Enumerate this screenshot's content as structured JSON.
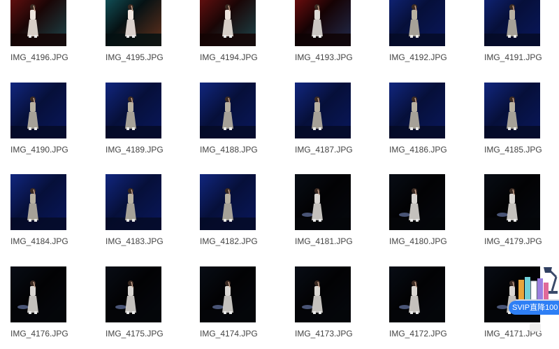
{
  "files": [
    {
      "name": "IMG_4196.JPG",
      "scene": "red-stage"
    },
    {
      "name": "IMG_4195.JPG",
      "scene": "teal-stage"
    },
    {
      "name": "IMG_4194.JPG",
      "scene": "red-stage"
    },
    {
      "name": "IMG_4193.JPG",
      "scene": "red-stage-far"
    },
    {
      "name": "IMG_4192.JPG",
      "scene": "blue-stage"
    },
    {
      "name": "IMG_4191.JPG",
      "scene": "blue-stage"
    },
    {
      "name": "IMG_4190.JPG",
      "scene": "blue-stage"
    },
    {
      "name": "IMG_4189.JPG",
      "scene": "blue-stage"
    },
    {
      "name": "IMG_4188.JPG",
      "scene": "blue-stage"
    },
    {
      "name": "IMG_4187.JPG",
      "scene": "blue-stage"
    },
    {
      "name": "IMG_4186.JPG",
      "scene": "blue-stage"
    },
    {
      "name": "IMG_4185.JPG",
      "scene": "blue-stage"
    },
    {
      "name": "IMG_4184.JPG",
      "scene": "blue-stage"
    },
    {
      "name": "IMG_4183.JPG",
      "scene": "blue-stage"
    },
    {
      "name": "IMG_4182.JPG",
      "scene": "blue-stage"
    },
    {
      "name": "IMG_4181.JPG",
      "scene": "dark-stage"
    },
    {
      "name": "IMG_4180.JPG",
      "scene": "dark-stage"
    },
    {
      "name": "IMG_4179.JPG",
      "scene": "dark-stage"
    },
    {
      "name": "IMG_4176.JPG",
      "scene": "dark-stage"
    },
    {
      "name": "IMG_4175.JPG",
      "scene": "dark-stage"
    },
    {
      "name": "IMG_4174.JPG",
      "scene": "dark-stage"
    },
    {
      "name": "IMG_4173.JPG",
      "scene": "dark-stage"
    },
    {
      "name": "IMG_4172.JPG",
      "scene": "dark-stage"
    },
    {
      "name": "IMG_4171.JPG",
      "scene": "dark-stage"
    }
  ],
  "svip_badge": {
    "label": "SVIP直降100",
    "color": "#2e7ff5"
  }
}
